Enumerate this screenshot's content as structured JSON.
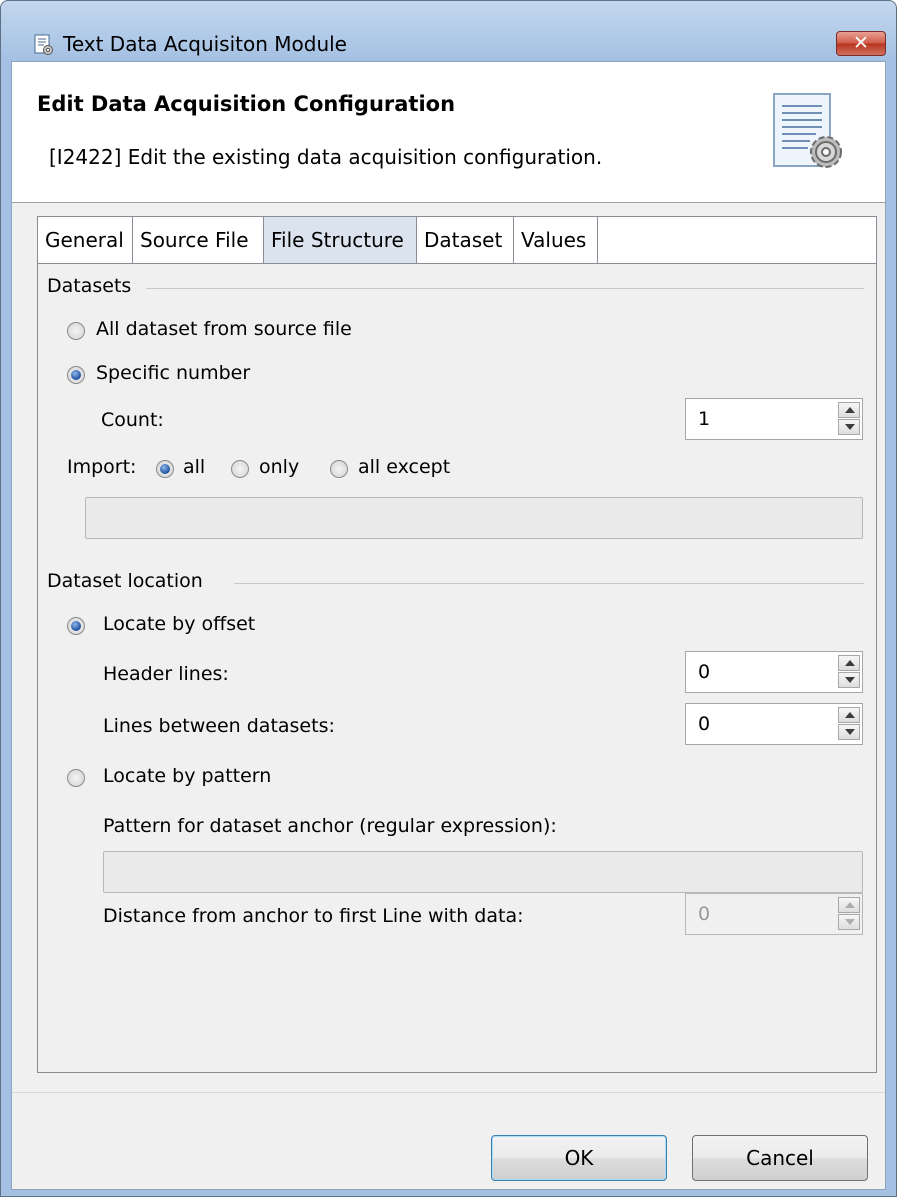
{
  "window": {
    "title": "Text Data Acquisiton Module",
    "close_label": "✕"
  },
  "header": {
    "title": "Edit Data Acquisition Configuration",
    "description": "[I2422] Edit the existing data acquisition configuration."
  },
  "tabs": [
    {
      "label": "General",
      "active": false
    },
    {
      "label": "Source File",
      "active": false
    },
    {
      "label": "File Structure",
      "active": true
    },
    {
      "label": "Dataset",
      "active": false
    },
    {
      "label": "Values",
      "active": false
    }
  ],
  "datasets": {
    "group_label": "Datasets",
    "all_label": "All dataset from source file",
    "all_selected": false,
    "specific_label": "Specific number",
    "specific_selected": true,
    "count_label": "Count:",
    "count_value": "1",
    "import_label": "Import:",
    "import_options": [
      {
        "label": "all",
        "selected": true
      },
      {
        "label": "only",
        "selected": false
      },
      {
        "label": "all except",
        "selected": false
      }
    ],
    "import_filter_value": ""
  },
  "location": {
    "group_label": "Dataset location",
    "offset_label": "Locate by offset",
    "offset_selected": true,
    "header_lines_label": "Header lines:",
    "header_lines_value": "0",
    "lines_between_label": "Lines between datasets:",
    "lines_between_value": "0",
    "pattern_label": "Locate by pattern",
    "pattern_selected": false,
    "pattern_anchor_label": "Pattern for dataset anchor (regular expression):",
    "pattern_anchor_value": "",
    "distance_label": "Distance from anchor to first Line with data:",
    "distance_value": "0"
  },
  "footer": {
    "ok_label": "OK",
    "cancel_label": "Cancel"
  },
  "colors": {
    "title_bar": "#aec8e6",
    "active_tab": "#dbe3ef",
    "radio_dot": "#1d4fa0"
  }
}
